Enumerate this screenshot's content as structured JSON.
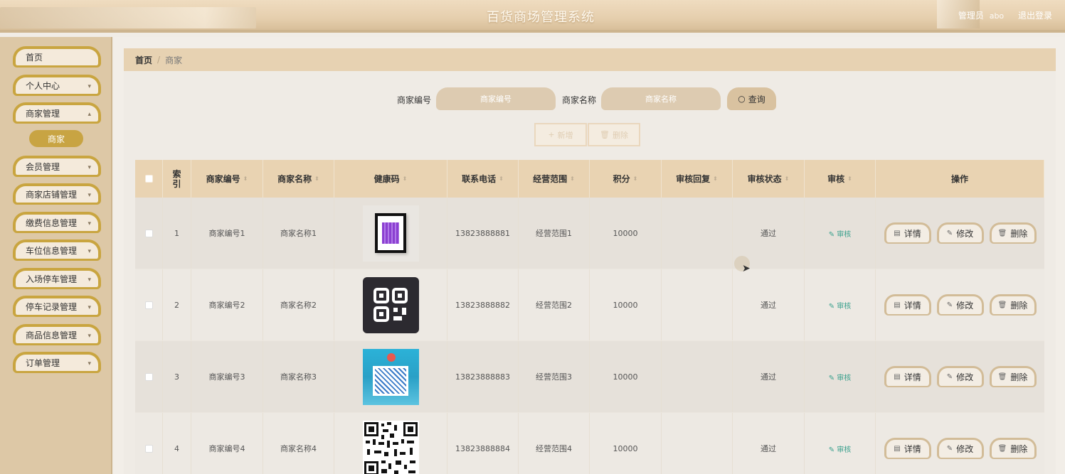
{
  "header": {
    "title": "百货商场管理系统",
    "role_label": "管理员",
    "username": "abo",
    "logout_label": "退出登录"
  },
  "sidebar": {
    "items": [
      {
        "label": "首页",
        "has_chevron": false
      },
      {
        "label": "个人中心",
        "has_chevron": true
      },
      {
        "label": "商家管理",
        "has_chevron": true
      },
      {
        "label": "会员管理",
        "has_chevron": true
      },
      {
        "label": "商家店铺管理",
        "has_chevron": true
      },
      {
        "label": "缴费信息管理",
        "has_chevron": true
      },
      {
        "label": "车位信息管理",
        "has_chevron": true
      },
      {
        "label": "入场停车管理",
        "has_chevron": true
      },
      {
        "label": "停车记录管理",
        "has_chevron": true
      },
      {
        "label": "商品信息管理",
        "has_chevron": true
      },
      {
        "label": "订单管理",
        "has_chevron": true
      }
    ],
    "active_sub_item": "商家",
    "chevron_icon": "chevron-down-icon",
    "accent_color": "#c9a540"
  },
  "breadcrumb": {
    "home": "首页",
    "separator": "/",
    "current": "商家"
  },
  "search": {
    "merchant_no_label": "商家编号",
    "merchant_no_placeholder": "商家编号",
    "merchant_no_value": "",
    "merchant_name_label": "商家名称",
    "merchant_name_placeholder": "商家名称",
    "merchant_name_value": "",
    "query_label": "查询",
    "query_icon": "search-icon"
  },
  "actions": {
    "add_label": "新增",
    "add_icon": "plus-icon",
    "delete_label": "删除",
    "delete_icon": "trash-icon"
  },
  "table": {
    "headers": [
      "索引",
      "商家编号",
      "商家名称",
      "健康码",
      "联系电话",
      "经营范围",
      "积分",
      "审核回复",
      "审核状态",
      "审核",
      "操作"
    ],
    "rows": [
      {
        "index": "1",
        "no": "商家编号1",
        "name": "商家名称1",
        "phone": "13823888881",
        "scope": "经营范围1",
        "points": "10000",
        "reply": "",
        "status": "通过",
        "audit": "审核"
      },
      {
        "index": "2",
        "no": "商家编号2",
        "name": "商家名称2",
        "phone": "13823888882",
        "scope": "经营范围2",
        "points": "10000",
        "reply": "",
        "status": "通过",
        "audit": "审核"
      },
      {
        "index": "3",
        "no": "商家编号3",
        "name": "商家名称3",
        "phone": "13823888883",
        "scope": "经营范围3",
        "points": "10000",
        "reply": "",
        "status": "通过",
        "audit": "审核"
      },
      {
        "index": "4",
        "no": "商家编号4",
        "name": "商家名称4",
        "phone": "13823888884",
        "scope": "经营范围4",
        "points": "10000",
        "reply": "",
        "status": "通过",
        "audit": "审核"
      }
    ],
    "row_buttons": {
      "detail_label": "详情",
      "detail_icon": "document-icon",
      "edit_label": "修改",
      "edit_icon": "pencil-icon",
      "delete_label": "删除",
      "delete_icon": "trash-icon"
    },
    "audit_link_color": "#3aa08d"
  }
}
